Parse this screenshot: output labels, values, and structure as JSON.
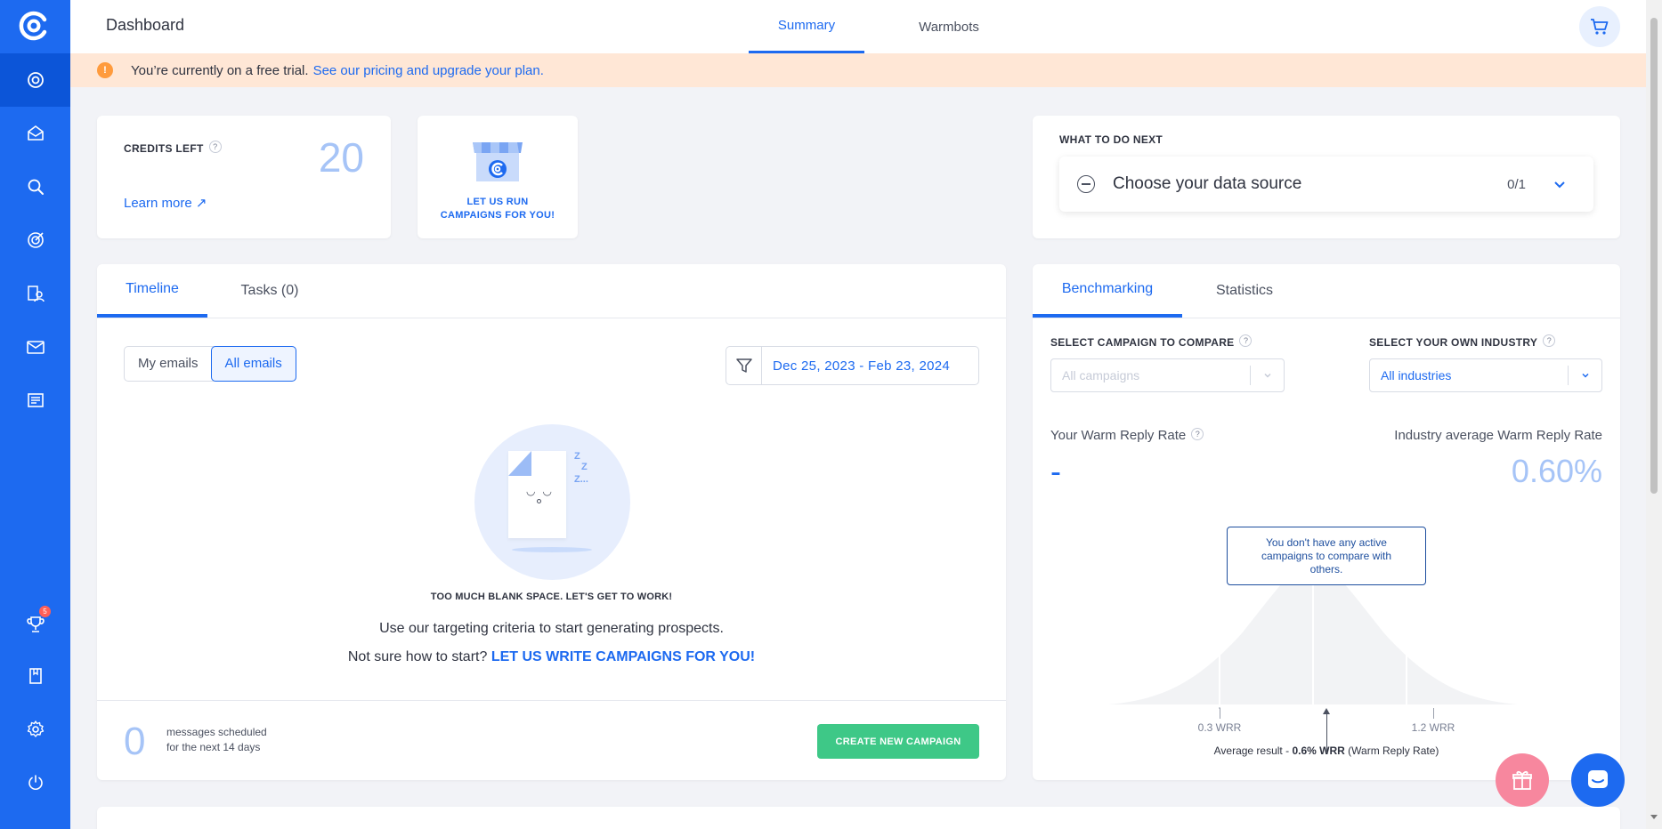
{
  "header": {
    "title": "Dashboard",
    "tabs": [
      {
        "label": "Summary"
      },
      {
        "label": "Warmbots"
      }
    ]
  },
  "trial": {
    "text": "You’re currently on a free trial.",
    "link": "See our pricing and upgrade your plan."
  },
  "sidebar": {
    "trophy_badge": "5"
  },
  "credits": {
    "label": "CREDITS LEFT",
    "help": "?",
    "value": "20",
    "learn_more": "Learn more ↗"
  },
  "promo": {
    "line1": "LET US RUN",
    "line2": "CAMPAIGNS FOR YOU!"
  },
  "todo": {
    "label": "WHAT TO DO NEXT",
    "item": "Choose your data source",
    "progress": "0/1"
  },
  "timeline": {
    "tabs": [
      {
        "label": "Timeline"
      },
      {
        "label": "Tasks (0)"
      }
    ],
    "filters": [
      {
        "label": "My emails"
      },
      {
        "label": "All emails"
      }
    ],
    "date_range": "Dec 25, 2023 - Feb 23, 2024",
    "empty_title": "TOO MUCH BLANK SPACE. LET'S GET TO WORK!",
    "empty_text": "Use our targeting criteria to start generating prospects.",
    "not_sure": "Not sure how to start?",
    "write_link": "LET US WRITE CAMPAIGNS FOR YOU!",
    "zzz": [
      "Z",
      "Z",
      "Z..."
    ],
    "scheduled_count": "0",
    "scheduled_line1": "messages scheduled",
    "scheduled_line2": "for the next 14 days",
    "create_button": "CREATE NEW CAMPAIGN"
  },
  "bench": {
    "tabs": [
      {
        "label": "Benchmarking"
      },
      {
        "label": "Statistics"
      }
    ],
    "campaign_label": "SELECT CAMPAIGN TO COMPARE",
    "campaign_placeholder": "All campaigns",
    "industry_label": "SELECT YOUR OWN INDUSTRY",
    "industry_value": "All industries",
    "your_rate_label": "Your Warm Reply Rate",
    "your_rate_value": "-",
    "industry_rate_label": "Industry average Warm Reply Rate",
    "industry_rate_value": "0.60%",
    "tooltip": "You don't have any active campaigns to compare with others.",
    "tick_low": "0.3 WRR",
    "tick_high": "1.2 WRR",
    "avg_prefix": "Average result -",
    "avg_value": "0.6% WRR",
    "avg_suffix": "(Warm Reply Rate)"
  },
  "colors": {
    "primary": "#1d6af0",
    "sidebar": "#1d6af0",
    "success": "#3ec887",
    "warning": "#ff9b3d",
    "trial_bg": "#ffe7d6",
    "gift": "#f7879e"
  }
}
